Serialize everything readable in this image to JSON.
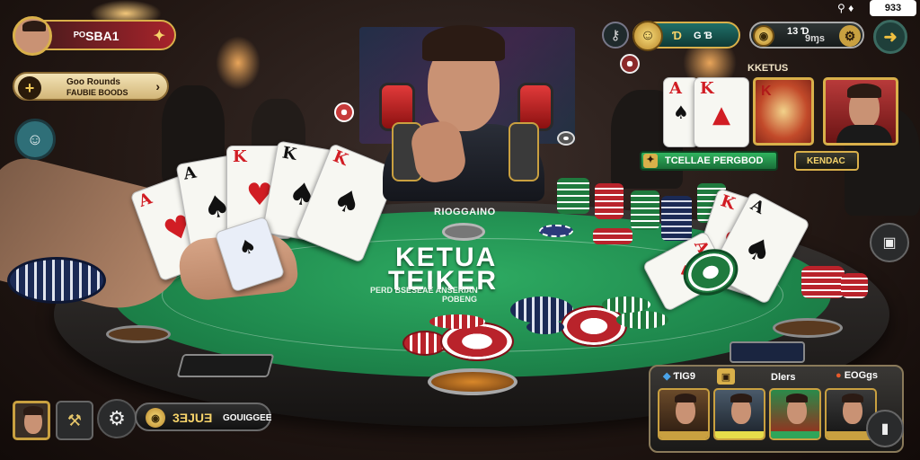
{
  "top_left": {
    "player_name": "ᴾᴼSBA1",
    "flag_icon": "gift-icon",
    "menu_title": "Goo Rounds",
    "menu_subtitle": "FAUBIE BOODS"
  },
  "top_center": {
    "avatar_name": "dealer-portrait"
  },
  "top_right": {
    "time": "933",
    "balance_1_label": "Ɗ",
    "balance_1_value": "G Ɓ",
    "balance_2_value": "13 Ɗ",
    "balance_2_sub": "9ɱs",
    "seat_title": "KKETUS",
    "highlight_label": "TCELLAE PERGBOD",
    "side_button": "KENDAC"
  },
  "table": {
    "pot_label": "RIOGGAINO",
    "title_line_1": "KETUA",
    "title_line_2": "TEIKER",
    "subtitle": "PERD BSESEAE ANSERIAN",
    "subtitle_2": "POBENG"
  },
  "bottom_left": {
    "chip_count": "3ƎJUƎ",
    "chip_sub": "GOUIGGEE"
  },
  "bottom_right": {
    "stat_1": "ƬIG9",
    "stat_2": "Dlers",
    "stat_3": "EOGgs"
  },
  "colors": {
    "felt": "#1f8a4e",
    "rail": "#2b2826",
    "accent_gold": "#d9b04a",
    "accent_red": "#b3202a",
    "accent_green": "#2fa55a"
  }
}
